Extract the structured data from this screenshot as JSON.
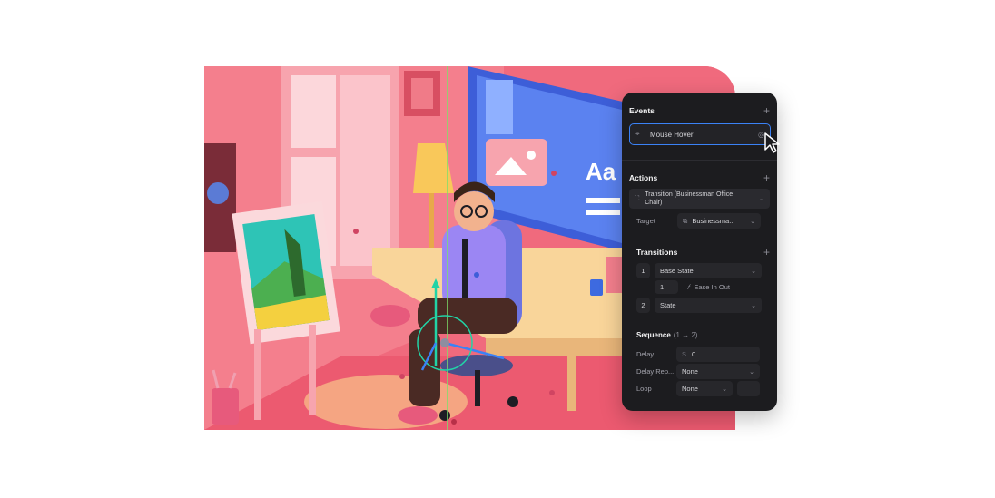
{
  "events": {
    "title": "Events",
    "add": "+",
    "selected_event": "Mouse Hover"
  },
  "actions": {
    "title": "Actions",
    "add": "+",
    "action_value": "Transition (Businessman Office Chair)",
    "target_label": "Target",
    "target_value": "Businessma..."
  },
  "transitions": {
    "title": "Transitions",
    "add": "+",
    "items": [
      {
        "index": "1",
        "state": "Base State"
      },
      {
        "index": "2",
        "state": "State"
      }
    ],
    "duration": "1",
    "easing_icon": "𝑓",
    "easing": "Ease In Out"
  },
  "sequence": {
    "title": "Sequence",
    "subtitle": "(1 → 2)",
    "delay_label": "Delay",
    "delay_unit": "S",
    "delay_value": "0",
    "delay_repeat_label": "Delay Rep...",
    "delay_repeat_value": "None",
    "loop_label": "Loop",
    "loop_value": "None"
  },
  "scene": {
    "monitor_text": "Aa"
  },
  "colors": {
    "panel_bg": "#1c1c1f",
    "accent": "#3b82f6",
    "scene_bg": "#f2657a"
  }
}
